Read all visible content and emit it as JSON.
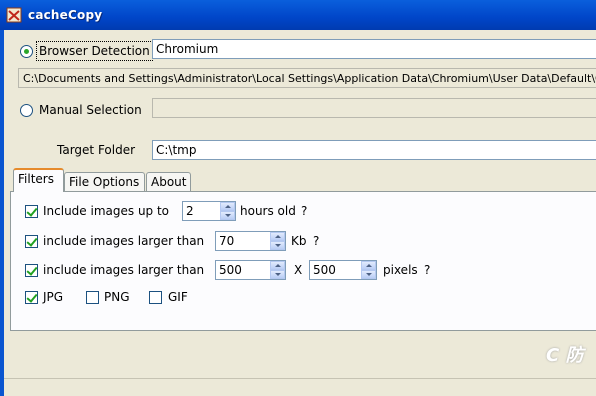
{
  "window": {
    "title": "cacheCopy"
  },
  "browser_detection": {
    "label": "Browser Detection",
    "selected": true,
    "browser_value": "Chromium",
    "cache_path": "C:\\Documents and Settings\\Administrator\\Local Settings\\Application Data\\Chromium\\User Data\\Default\\Cache"
  },
  "manual_selection": {
    "label": "Manual Selection",
    "selected": false,
    "value": ""
  },
  "target_folder": {
    "label": "Target Folder",
    "value": "C:\\tmp"
  },
  "tabs": [
    {
      "label": "Filters",
      "active": true
    },
    {
      "label": "File Options",
      "active": false
    },
    {
      "label": "About",
      "active": false
    }
  ],
  "filters": {
    "hours": {
      "label": "Include images up to",
      "checked": true,
      "value": "2",
      "unit": "hours old",
      "help": "?"
    },
    "size": {
      "label": "include images larger than",
      "checked": true,
      "value": "70",
      "unit": "Kb",
      "help": "?"
    },
    "dimensions": {
      "label": "include images larger than",
      "checked": true,
      "width": "500",
      "times": "X",
      "height": "500",
      "unit": "pixels",
      "help": "?"
    },
    "types": [
      {
        "label": "JPG",
        "checked": true
      },
      {
        "label": "PNG",
        "checked": false
      },
      {
        "label": "GIF",
        "checked": false
      }
    ]
  },
  "watermark": "C 防",
  "colors": {
    "titlebar": "#0a55d0",
    "tab_highlight": "#e68b2c",
    "check": "#21a121"
  }
}
